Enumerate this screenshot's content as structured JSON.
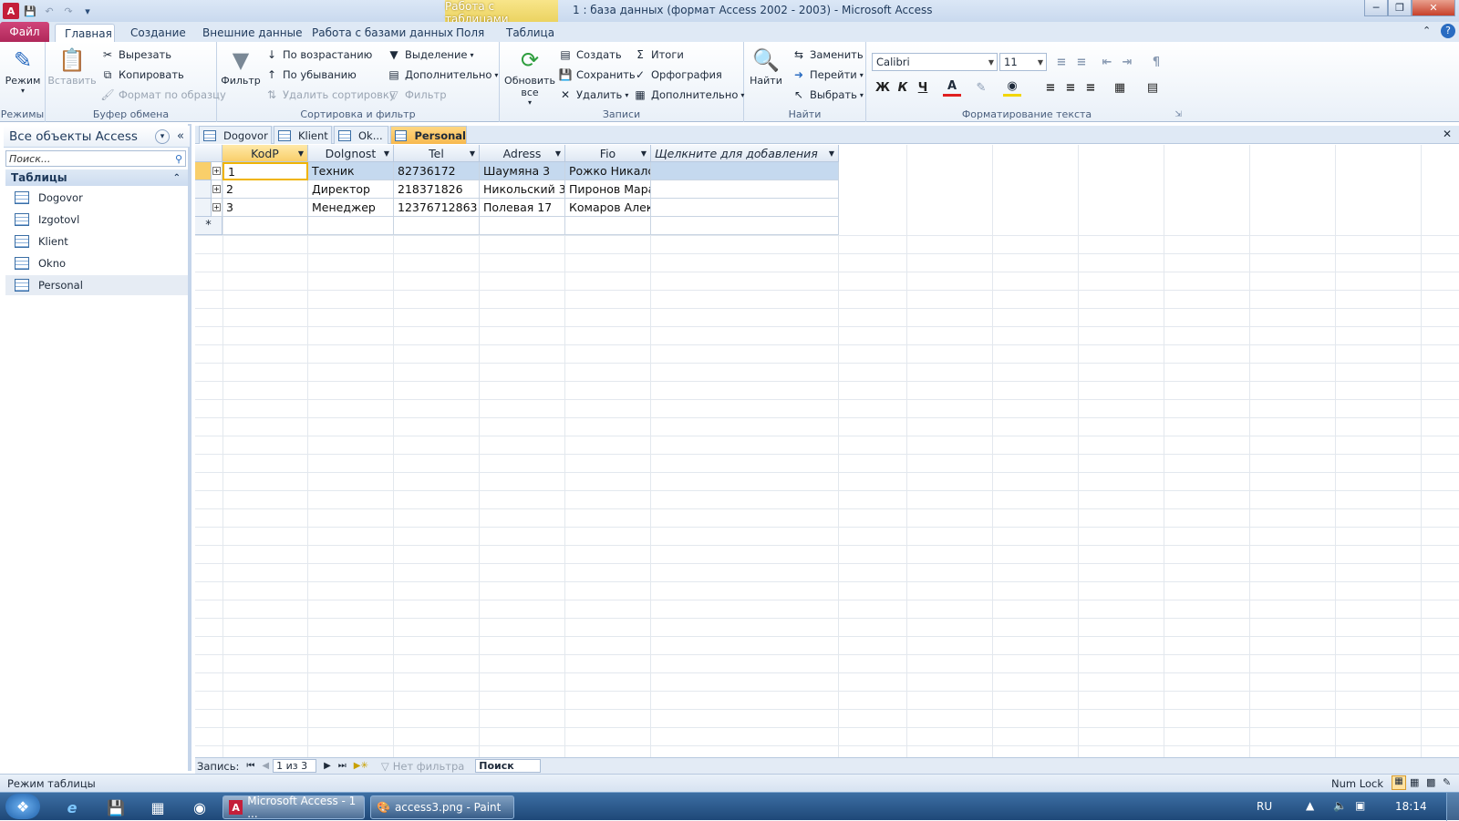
{
  "titlebar": {
    "title": "1 : база данных (формат Access 2002 - 2003)  -  Microsoft Access",
    "context_tab": "Работа с таблицами"
  },
  "ribbon_tabs": {
    "file": "Файл",
    "tabs": [
      "Главная",
      "Создание",
      "Внешние данные",
      "Работа с базами данных",
      "Поля",
      "Таблица"
    ]
  },
  "ribbon": {
    "views": {
      "mode": "Режим",
      "label": "Режимы"
    },
    "clipboard": {
      "paste": "Вставить",
      "cut": "Вырезать",
      "copy": "Копировать",
      "format_painter": "Формат по образцу",
      "label": "Буфер обмена"
    },
    "sort_filter": {
      "filter": "Фильтр",
      "ascending": "По возрастанию",
      "descending": "По убыванию",
      "remove_sort": "Удалить сортировку",
      "selection": "Выделение",
      "advanced": "Дополнительно",
      "toggle_filter": "Фильтр",
      "label": "Сортировка и фильтр"
    },
    "records": {
      "refresh": "Обновить все",
      "new": "Создать",
      "save": "Сохранить",
      "delete": "Удалить",
      "totals": "Итоги",
      "spelling": "Орфография",
      "more": "Дополнительно",
      "label": "Записи"
    },
    "find": {
      "find": "Найти",
      "replace": "Заменить",
      "goto": "Перейти",
      "select": "Выбрать",
      "label": "Найти"
    },
    "text_format": {
      "font": "Calibri",
      "size": "11",
      "bold": "Ж",
      "italic": "К",
      "underline": "Ч",
      "label": "Форматирование текста"
    }
  },
  "nav": {
    "header": "Все объекты Access",
    "search_placeholder": "Поиск...",
    "group": "Таблицы",
    "items": [
      "Dogovor",
      "Izgotovl",
      "Klient",
      "Okno",
      "Personal"
    ]
  },
  "doc_tabs": [
    "Dogovor",
    "Klient",
    "Ok...",
    "Personal"
  ],
  "datasheet": {
    "columns": [
      "KodP",
      "Dolgnost",
      "Tel",
      "Adress",
      "Fio",
      "Щелкните для добавления"
    ],
    "rows": [
      [
        "1",
        "Техник",
        "82736172",
        "Шаумяна 3",
        "Рожко Никалс"
      ],
      [
        "2",
        "Директор",
        "218371826",
        "Никольский 3",
        "Пиронов Мара"
      ],
      [
        "3",
        "Менеджер",
        "12376712863",
        "Полевая 17",
        "Комаров Алек"
      ]
    ],
    "new_row_marker": "*"
  },
  "record_nav": {
    "label": "Запись:",
    "position": "1 из 3",
    "filter": "Нет фильтра",
    "search": "Поиск"
  },
  "status": {
    "mode": "Режим таблицы",
    "numlock": "Num Lock"
  },
  "taskbar": {
    "access": "Microsoft Access - 1 ...",
    "paint": "access3.png - Paint",
    "lang": "RU",
    "time": "18:14"
  },
  "colors": {
    "file_tab": "#b0285a",
    "context_tab": "#e9d05a",
    "active_doc_tab": "#f7b94e",
    "selected_row": "#c5d9ef"
  }
}
